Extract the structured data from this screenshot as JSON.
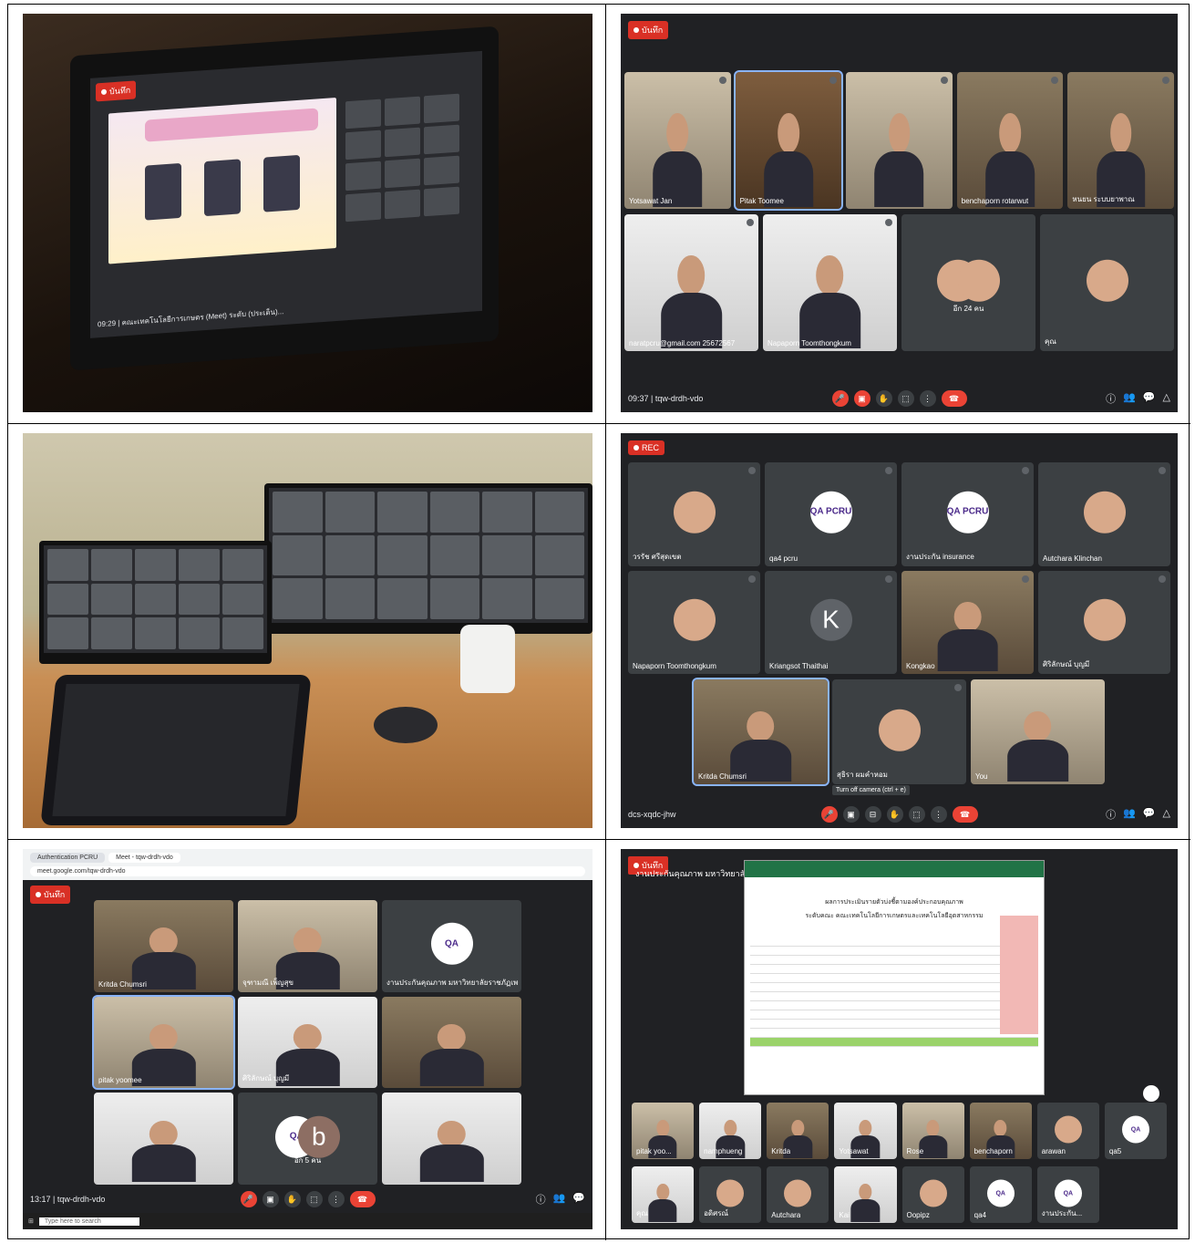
{
  "panel1": {
    "rec_label": "บันทึก",
    "time": "09:29",
    "meeting_title": "คณะเทคโนโลยีการเกษตร (Meet) ระดับ (ประเด็น)..."
  },
  "panel2": {
    "rec_label": "บันทึก",
    "time": "09:37",
    "meeting_code": "tqw-drdh-vdo",
    "tiles": [
      {
        "name": "Yotsawat Jan",
        "bg": "room"
      },
      {
        "name": "Pitak Toomee",
        "bg": "wood",
        "highlight": true
      },
      {
        "name": "",
        "bg": "room"
      },
      {
        "name": "benchaporn rotarwut",
        "bg": "bk"
      },
      {
        "name": "หนยน ระบบยาพาณ",
        "bg": "bk"
      },
      {
        "name": "naratpcru@gmail.com 25672567",
        "bg": "white"
      },
      {
        "name": "Napaporn Toomthongkum",
        "bg": "white"
      },
      {
        "name": "อีก 24 คน",
        "bg": "dark"
      },
      {
        "name": "คุณ",
        "bg": "dark"
      }
    ]
  },
  "panel4": {
    "rec_label": "REC",
    "meeting_code": "dcs-xqdc-jhw",
    "tooltip": "Turn off camera (ctrl + e)",
    "tiles": [
      {
        "name": "วรรัช ศรีสุดเขต",
        "avatar": "face"
      },
      {
        "name": "qa4 pcru",
        "avatar": "QA PCRU"
      },
      {
        "name": "งานประกัน insurance",
        "avatar": "QA PCRU"
      },
      {
        "name": "Autchara Klinchan",
        "avatar": "face"
      },
      {
        "name": "Napaporn Toomthongkum",
        "avatar": "face"
      },
      {
        "name": "Kriangsot Thaithai",
        "avatar": "K"
      },
      {
        "name": "Kongkao",
        "avatar": "video"
      },
      {
        "name": "ศิริลักษณ์ บุญมี",
        "avatar": "face"
      },
      {
        "name": "Kritda Chumsri",
        "avatar": "video"
      },
      {
        "name": "สุธิรา ผมคำหอม",
        "avatar": "face"
      },
      {
        "name": "You",
        "avatar": "video"
      }
    ]
  },
  "panel5": {
    "rec_label": "บันทึก",
    "time": "13:17",
    "meeting_code": "tqw-drdh-vdo",
    "url": "meet.google.com/tqw-drdh-vdo",
    "tab1": "Authentication PCRU",
    "tab2": "Meet - tqw-drdh-vdo",
    "search_placeholder": "Type here to search",
    "tiles": [
      {
        "name": "Kritda Chumsri",
        "bg": "bk"
      },
      {
        "name": "จุฑามณี เพ็ญสุข",
        "bg": "room"
      },
      {
        "name": "งานประกันคุณภาพ มหาวิทยาลัยราชภัฏเพชรบูรณ์",
        "bg": "qa"
      },
      {
        "name": "pitak yoomee",
        "bg": "room",
        "highlight": true
      },
      {
        "name": "ศิริลักษณ์ บุญมี",
        "bg": "white"
      },
      {
        "name": "",
        "bg": "bk"
      },
      {
        "name": "",
        "bg": "white"
      },
      {
        "name": "อีก 5 คน",
        "bg": "dark"
      },
      {
        "name": "",
        "bg": "white"
      }
    ]
  },
  "panel6": {
    "rec_label": "บันทึก",
    "caption": "งานประกันคุณภาพ มหาวิทยาลัยราชภัฏเพชรบูรณ์",
    "sheet_title": "ผลการประเมินรายตัวบ่งชี้ตามองค์ประกอบคุณภาพ",
    "sheet_subtitle": "ระดับคณะ คณะเทคโนโลยีการเกษตรและเทคโนโลยีอุตสาหกรรม",
    "participants": [
      "pitak yoo...",
      "namphueng",
      "Kritda",
      "Yotsawat",
      "Rose",
      "benchaporn",
      "arawan",
      "qa5",
      "คุณ",
      "อดิศรณ์",
      "Autchara",
      "Kai",
      "Oopipz",
      "qa4",
      "งานประกัน..."
    ]
  }
}
